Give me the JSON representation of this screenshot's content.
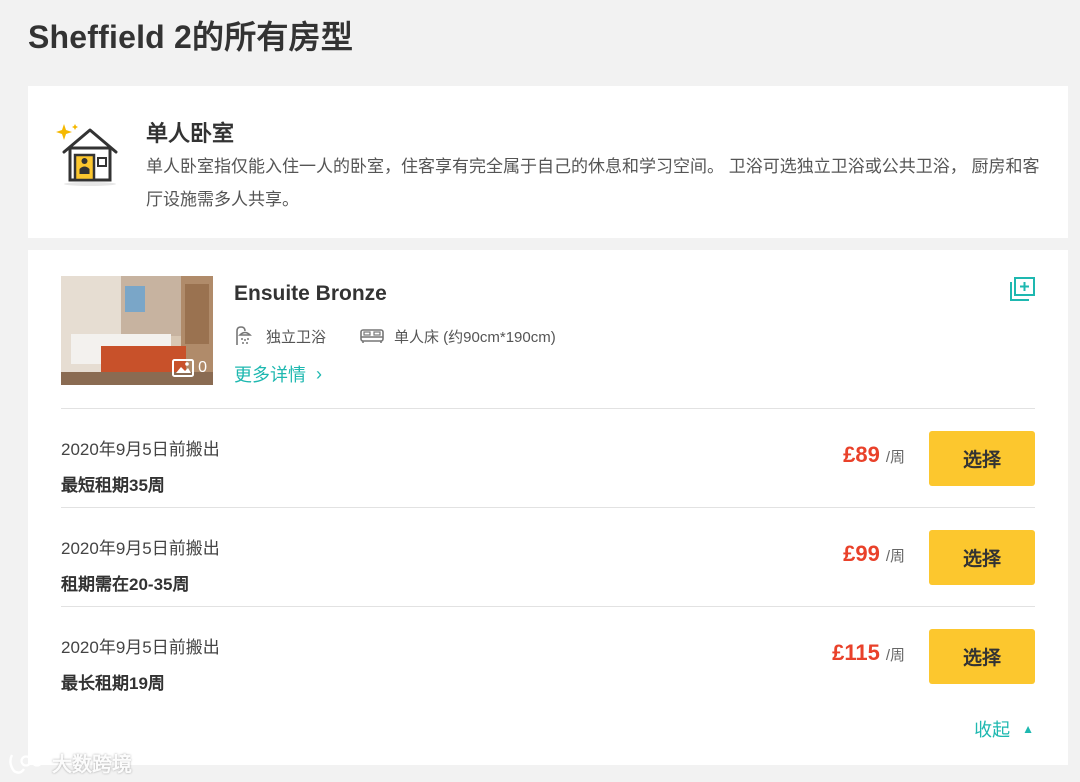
{
  "page": {
    "title": "Sheffield 2的所有房型"
  },
  "room_type": {
    "icon": "house-single-person-icon",
    "title": "单人卧室",
    "description": "单人卧室指仅能入住一人的卧室，住客享有完全属于自己的休息和学习空间。 卫浴可选独立卫浴或公共卫浴， 厨房和客厅设施需多人共享。"
  },
  "listing": {
    "name": "Ensuite Bronze",
    "photo_count": "0",
    "features": [
      {
        "icon": "shower-icon",
        "label": "独立卫浴"
      },
      {
        "icon": "bed-icon",
        "label": "单人床 (约90cm*190cm)"
      }
    ],
    "more_details": "更多详情",
    "collapse": "收起",
    "offers": [
      {
        "move_out": "2020年9月5日前搬出",
        "term": "最短租期35周",
        "price": "£89",
        "unit": "/周",
        "button": "选择"
      },
      {
        "move_out": "2020年9月5日前搬出",
        "term": "租期需在20-35周",
        "price": "£99",
        "unit": "/周",
        "button": "选择"
      },
      {
        "move_out": "2020年9月5日前搬出",
        "term": "最长租期19周",
        "price": "£115",
        "unit": "/周",
        "button": "选择"
      }
    ]
  },
  "watermark": {
    "text": "大数跨境"
  },
  "colors": {
    "accent": "#1eb8b0",
    "price": "#e9412a",
    "button": "#fcc72e"
  }
}
